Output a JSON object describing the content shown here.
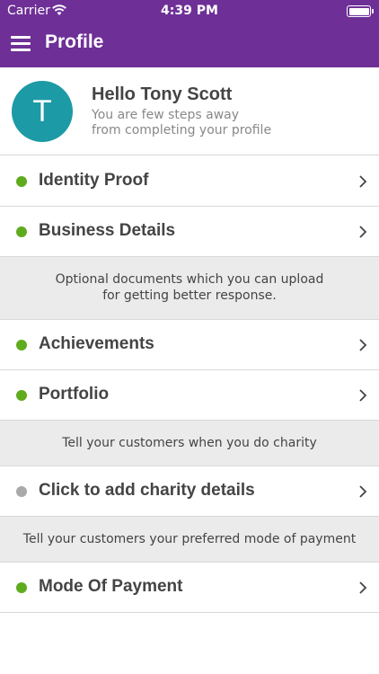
{
  "status_bar": {
    "carrier": "Carrier",
    "time": "4:39 PM",
    "battery_level": 1.0
  },
  "nav": {
    "title": "Profile"
  },
  "profile": {
    "avatar_initial": "T",
    "greeting": "Hello Tony Scott",
    "subtitle_line1": "You are few steps away",
    "subtitle_line2": "from completing your profile"
  },
  "rows": [
    {
      "label": "Identity Proof",
      "status": "complete"
    },
    {
      "label": "Business Details",
      "status": "complete"
    },
    {
      "label": "Achievements",
      "status": "complete"
    },
    {
      "label": "Portfolio",
      "status": "complete"
    },
    {
      "label": "Click to add charity details",
      "status": "pending"
    },
    {
      "label": "Mode Of Payment",
      "status": "complete"
    }
  ],
  "notes": {
    "optional_line1": "Optional documents which you can upload",
    "optional_line2": "for getting better response.",
    "charity": "Tell your customers when you do charity",
    "payment": "Tell your customers your preferred mode of payment"
  },
  "colors": {
    "brand": "#6e2f97",
    "avatar": "#1c9aa6",
    "status_complete": "#5fab1e",
    "status_pending": "#a9a9a9"
  }
}
